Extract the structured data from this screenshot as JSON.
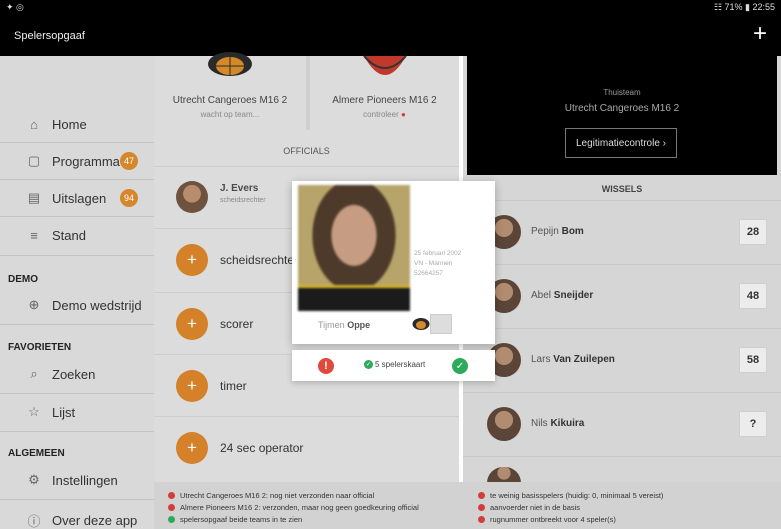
{
  "statusbar": {
    "left_icons": "✦ ◎",
    "right": "☷ 71% ▮ 22:55"
  },
  "appbar": {
    "title": "Spelersopgaaf",
    "add_label": "+"
  },
  "sidebar": {
    "items": [
      {
        "label": "Home",
        "icon": "home-icon",
        "glyph": "⌂"
      },
      {
        "label": "Programma",
        "icon": "calendar-icon",
        "glyph": "▢",
        "badge": "47"
      },
      {
        "label": "Uitslagen",
        "icon": "results-icon",
        "glyph": "▤",
        "badge": "94"
      },
      {
        "label": "Stand",
        "icon": "list-icon",
        "glyph": "≡"
      }
    ],
    "section_demo": "DEMO",
    "demo_item": {
      "label": "Demo wedstrijd",
      "glyph": "⊕"
    },
    "section_favorites": "FAVORIETEN",
    "favorites": [
      {
        "label": "Zoeken",
        "glyph": "⌕"
      },
      {
        "label": "Lijst",
        "glyph": "☆"
      }
    ],
    "section_general": "ALGEMEEN",
    "general": [
      {
        "label": "Instellingen",
        "glyph": "⚙"
      },
      {
        "label": "Over deze app",
        "glyph": "ⓘ"
      }
    ]
  },
  "teams": {
    "home": {
      "name": "Utrecht Cangeroes M16 2",
      "status": "wacht op team..."
    },
    "away": {
      "name": "Almere Pioneers M16 2",
      "status": "controleer"
    }
  },
  "officials": {
    "heading": "OFFICIALS",
    "filled": {
      "name": "J. Evers",
      "role": "scheidsrechter"
    },
    "rows": [
      "scheidsrechter",
      "scorer",
      "timer",
      "24 sec operator"
    ]
  },
  "home_panel": {
    "label": "Thuisteam",
    "team": "Utrecht Cangeroes M16 2",
    "button": "Legitimatiecontrole  ›"
  },
  "substitutes": {
    "heading": "WISSELS",
    "rows": [
      {
        "first": "Pepijn",
        "last": "Bom",
        "number": "28"
      },
      {
        "first": "Abel",
        "last": "Sneijder",
        "number": "48"
      },
      {
        "first": "Lars",
        "last": "Van Zuilepen",
        "number": "58"
      },
      {
        "first": "Nils",
        "last": "Kikuira",
        "number": "?"
      }
    ]
  },
  "footer": {
    "left": [
      {
        "text": "Utrecht Cangeroes M16 2: nog niet verzonden naar official",
        "status": "red"
      },
      {
        "text": "Almere Pioneers M16 2: verzonden, maar nog geen goedkeuring official",
        "status": "red"
      },
      {
        "text": "spelersopgaaf beide teams in te zien",
        "status": "green"
      }
    ],
    "right": [
      {
        "text": "te weinig basisspelers (huidig: 0, minimaal 5 vereist)",
        "status": "red"
      },
      {
        "text": "aanvoerder niet in de basis",
        "status": "red"
      },
      {
        "text": "rugnummer ontbreekt voor 4 speler(s)",
        "status": "red"
      }
    ]
  },
  "modal": {
    "player_first": "Tijmen",
    "player_last": "Oppe",
    "details": [
      "25 februari 2002",
      "VN - Mannen",
      "52664257"
    ],
    "card_label": "5 spelerskaart",
    "reject_glyph": "!",
    "accept_glyph": "✓",
    "check_glyph": "✓"
  },
  "colors": {
    "accent": "#d6862b",
    "error": "#d43b3b",
    "ok": "#2eaa5c"
  }
}
